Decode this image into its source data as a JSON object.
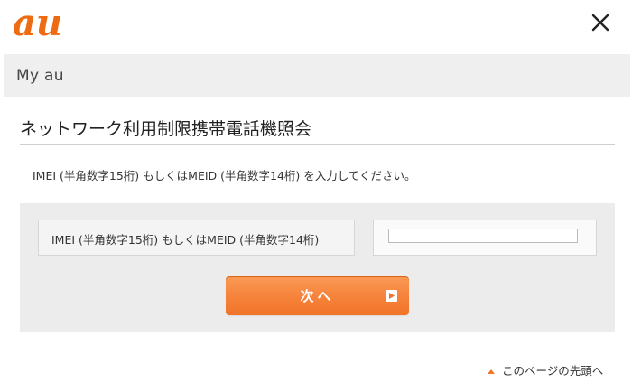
{
  "header": {
    "logo_text": "au",
    "close_icon": "close-icon",
    "brand_color": "#ee6b12"
  },
  "subbar": {
    "title": "My au"
  },
  "page": {
    "title": "ネットワーク利用制限携帯電話機照会",
    "instruction": "IMEI (半角数字15桁) もしくはMEID (半角数字14桁) を入力してください。"
  },
  "form": {
    "field_label": "IMEI (半角数字15桁) もしくはMEID (半角数字14桁)",
    "field_value": "",
    "field_placeholder": "",
    "next_label": "次へ",
    "next_icon": "play-icon",
    "button_color": "#f6823a"
  },
  "footer": {
    "pagetop_label": "このページの先頭へ",
    "pagetop_icon": "triangle-up-icon"
  }
}
